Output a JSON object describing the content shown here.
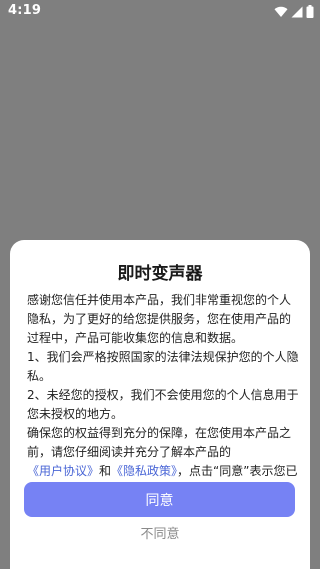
{
  "status_bar": {
    "time": "4:19",
    "icons": [
      "wifi-icon",
      "signal-icon",
      "battery-icon"
    ]
  },
  "dialog": {
    "title": "即时变声器",
    "intro": "感谢您信任并使用本产品，我们非常重视您的个人隐私，为了更好的给您提供服务，您在使用产品的过程中，产品可能收集您的信息和数据。",
    "item1": "1、我们会严格按照国家的法律法规保护您的个人隐私。",
    "item2": "2、未经您的授权，我们不会使用您的个人信息用于您未授权的地方。",
    "closing_part1": "确保您的权益得到充分的保障，在您使用本产品之前，请您仔细阅读并充分了解本产品的",
    "user_agreement_link": "《用户协议》",
    "and_text": "和",
    "privacy_policy_link": "《隐私政策》",
    "closing_part2": "，点击“同意”表示您已完全清楚并接受我们的条款。",
    "agree_label": "同意",
    "disagree_label": "不同意"
  },
  "colors": {
    "overlay": "#7f7f7f",
    "accent_button": "#7682f4",
    "link": "#4a66d6",
    "muted_text": "#8a8a8a"
  }
}
